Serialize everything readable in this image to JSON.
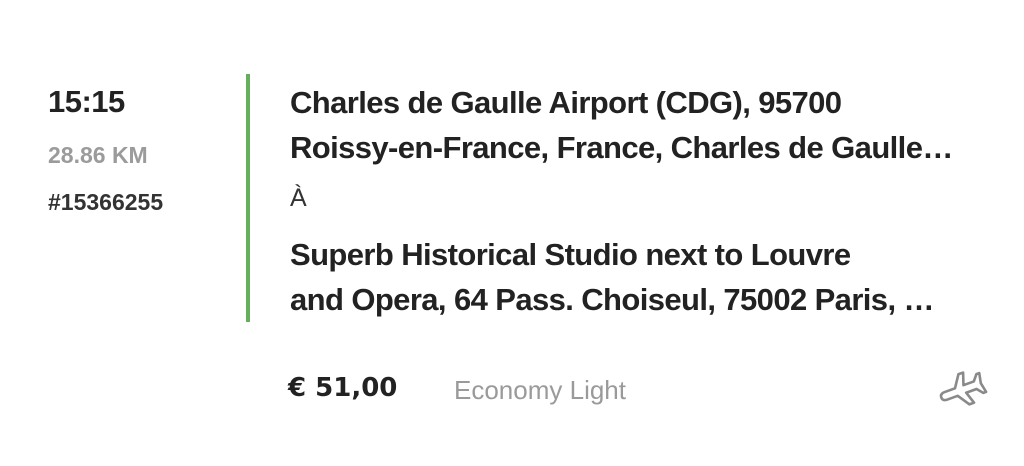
{
  "ride": {
    "time": "15:15",
    "distance": "28.86 KM",
    "booking_id": "#15366255",
    "pickup": {
      "line1": "Charles de Gaulle Airport (CDG), 95700",
      "line2": "Roissy-en-France, France, Charles de Gaulle…"
    },
    "to_label": "À",
    "dropoff": {
      "line1": "Superb Historical Studio next to Louvre",
      "line2": "and Opera, 64 Pass. Choiseul, 75002 Paris, …"
    },
    "price": "€ 51,00",
    "vehicle_class": "Economy Light",
    "trip_type_icon": "airplane-icon"
  },
  "colors": {
    "accent_divider": "#66b05d",
    "muted_text": "#9b9b9b"
  }
}
